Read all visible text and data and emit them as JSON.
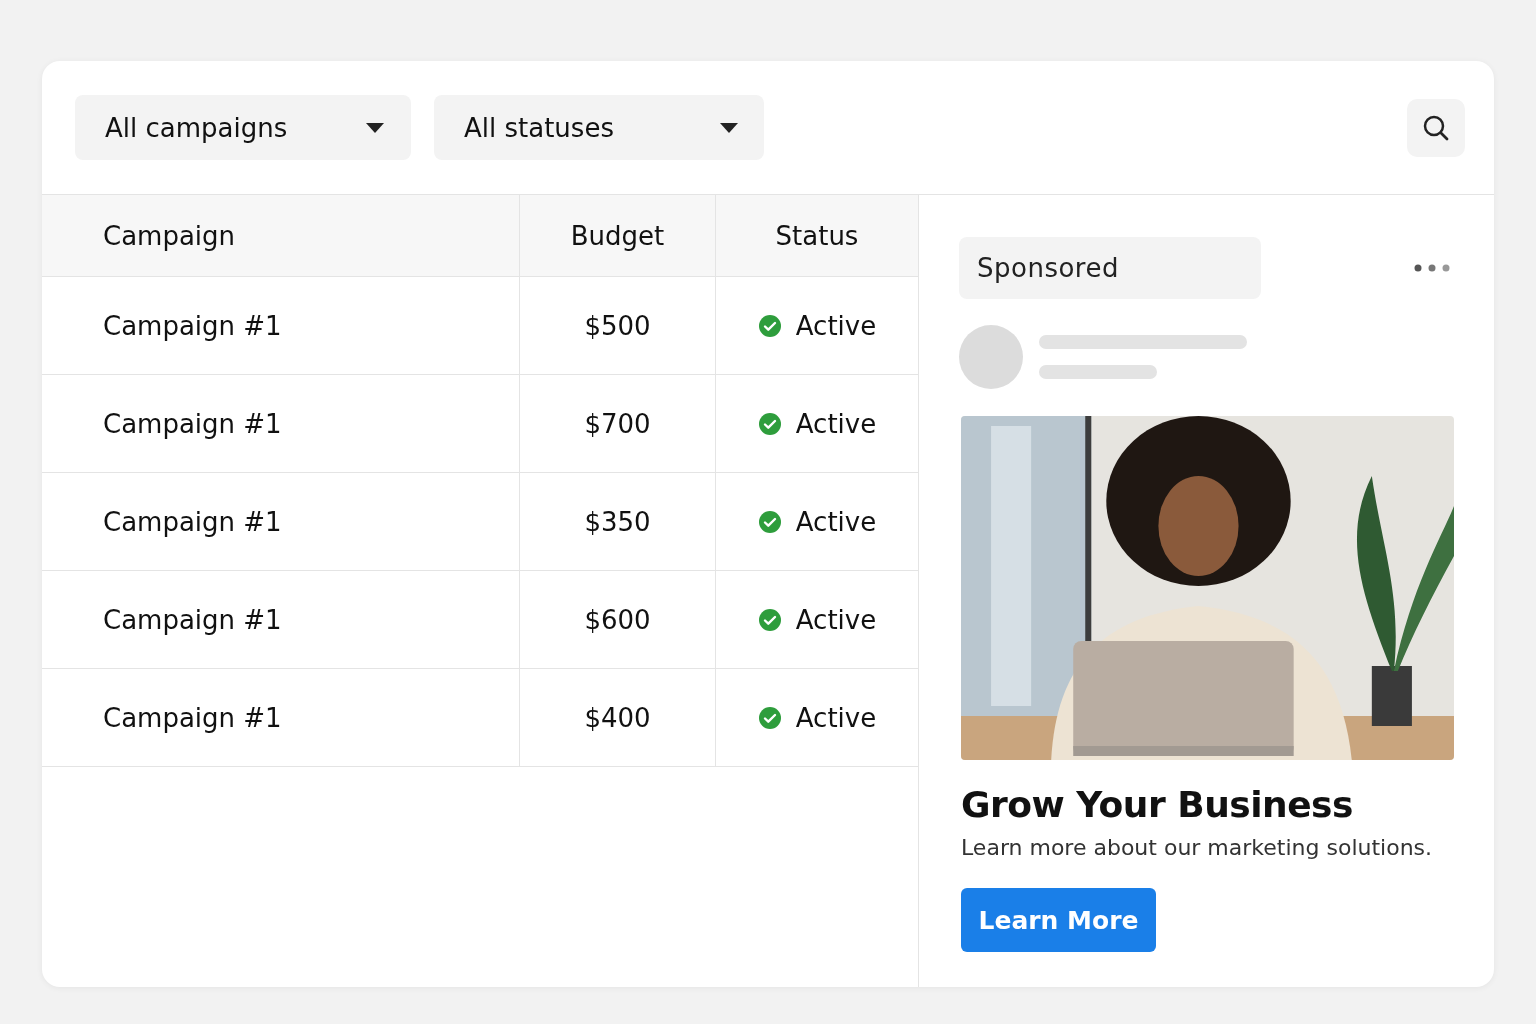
{
  "filters": [
    {
      "label": "All campaigns"
    },
    {
      "label": "All statuses"
    }
  ],
  "table": {
    "columns": [
      "Campaign",
      "Budget",
      "Status"
    ],
    "rows": [
      {
        "campaign": "Campaign #1",
        "budget": "$500",
        "status": "Active",
        "kind": "active"
      },
      {
        "campaign": "Campaign #1",
        "budget": "$700",
        "status": "Active",
        "kind": "active"
      },
      {
        "campaign": "Campaign #1",
        "budget": "$350",
        "status": "Active",
        "kind": "active"
      },
      {
        "campaign": "Campaign #1",
        "budget": "$600",
        "status": "Active",
        "kind": "active"
      },
      {
        "campaign": "Campaign #1",
        "budget": "$400",
        "status": "Active",
        "kind": "active"
      }
    ]
  },
  "ad": {
    "label": "Sponsored",
    "title": "Grow Your Business",
    "text": "Learn more about our marketing solutions.",
    "button": "Learn More"
  }
}
